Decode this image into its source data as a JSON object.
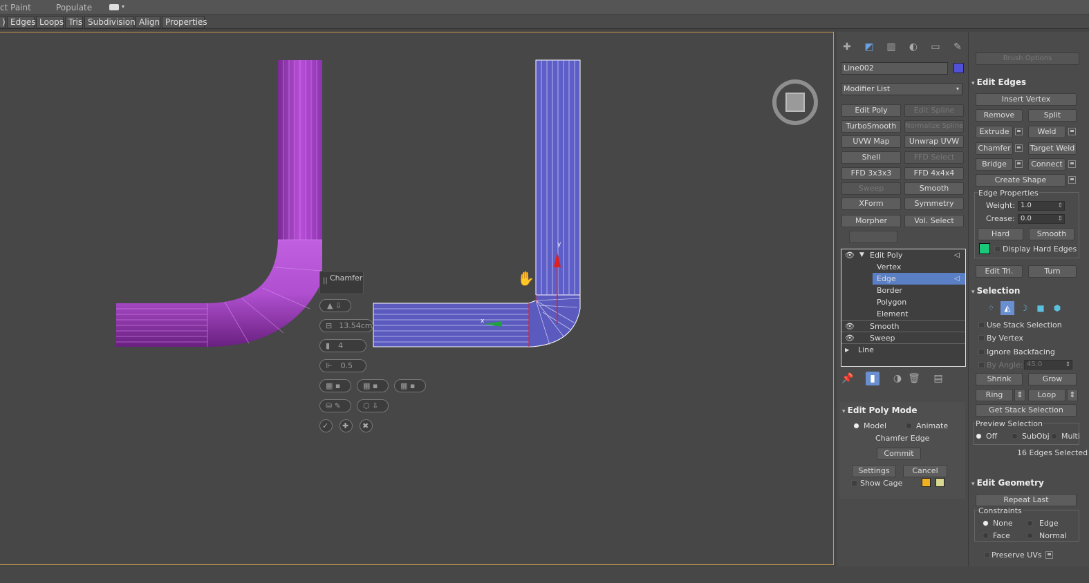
{
  "top_menu": {
    "left_item": "ct Paint",
    "populate": "Populate"
  },
  "ribbon": {
    "tabs": [
      ")",
      "Edges",
      "Loops",
      "Tris",
      "Subdivision",
      "Align",
      "Properties"
    ]
  },
  "viewport": {
    "caddy_title": "Chamfer",
    "amount": "13.54cm",
    "segments": "4",
    "tension": "0.5",
    "axis_y": "y",
    "axis_x": "x"
  },
  "command_panel": {
    "object_name": "Line002",
    "object_color": "#5050d8",
    "modifier_list": "Modifier List",
    "modifier_buttons": [
      [
        "Edit Poly",
        "Edit Spline"
      ],
      [
        "TurboSmooth",
        "Normalize Spline"
      ],
      [
        "UVW Map",
        "Unwrap UVW"
      ],
      [
        "Shell",
        "FFD Select"
      ],
      [
        "FFD 3x3x3",
        "FFD 4x4x4"
      ],
      [
        "Sweep",
        "Smooth"
      ],
      [
        "XForm",
        "Symmetry"
      ],
      [
        "Morpher",
        "Vol. Select"
      ]
    ],
    "stack": {
      "edit_poly": "Edit Poly",
      "sub": [
        "Vertex",
        "Edge",
        "Border",
        "Polygon",
        "Element"
      ],
      "smooth": "Smooth",
      "sweep": "Sweep",
      "line": "Line"
    },
    "edit_poly_mode": {
      "title": "Edit Poly Mode",
      "model": "Model",
      "animate": "Animate",
      "current_op": "Chamfer Edge",
      "commit": "Commit",
      "settings": "Settings",
      "cancel": "Cancel",
      "show_cage": "Show Cage",
      "cage_color_1": "#f0b020",
      "cage_color_2": "#d8d890"
    }
  },
  "rollout": {
    "brush_options": "Brush Options",
    "edit_edges": {
      "title": "Edit Edges",
      "insert_vertex": "Insert Vertex",
      "remove": "Remove",
      "split": "Split",
      "extrude": "Extrude",
      "weld": "Weld",
      "chamfer": "Chamfer",
      "target_weld": "Target Weld",
      "bridge": "Bridge",
      "connect": "Connect",
      "create_shape": "Create Shape",
      "edge_properties": "Edge Properties",
      "weight_label": "Weight:",
      "weight": "1.0",
      "crease_label": "Crease:",
      "crease": "0.0",
      "hard": "Hard",
      "smooth": "Smooth",
      "display_hard_edges": "Display Hard Edges",
      "hard_edge_color": "#19c878",
      "edit_tri": "Edit Tri.",
      "turn": "Turn"
    },
    "selection": {
      "title": "Selection",
      "use_stack": "Use Stack Selection",
      "by_vertex": "By Vertex",
      "ignore_backfacing": "Ignore Backfacing",
      "by_angle_label": "By Angle:",
      "by_angle": "45.0",
      "shrink": "Shrink",
      "grow": "Grow",
      "ring": "Ring",
      "loop": "Loop",
      "get_stack_selection": "Get Stack Selection",
      "preview_selection": "Preview Selection",
      "off": "Off",
      "subobj": "SubObj",
      "multi": "Multi",
      "status": "16 Edges Selected"
    },
    "edit_geometry": {
      "title": "Edit Geometry",
      "repeat_last": "Repeat Last",
      "constraints": "Constraints",
      "none": "None",
      "edge": "Edge",
      "face": "Face",
      "normal": "Normal",
      "preserve_uvs": "Preserve UVs"
    }
  }
}
